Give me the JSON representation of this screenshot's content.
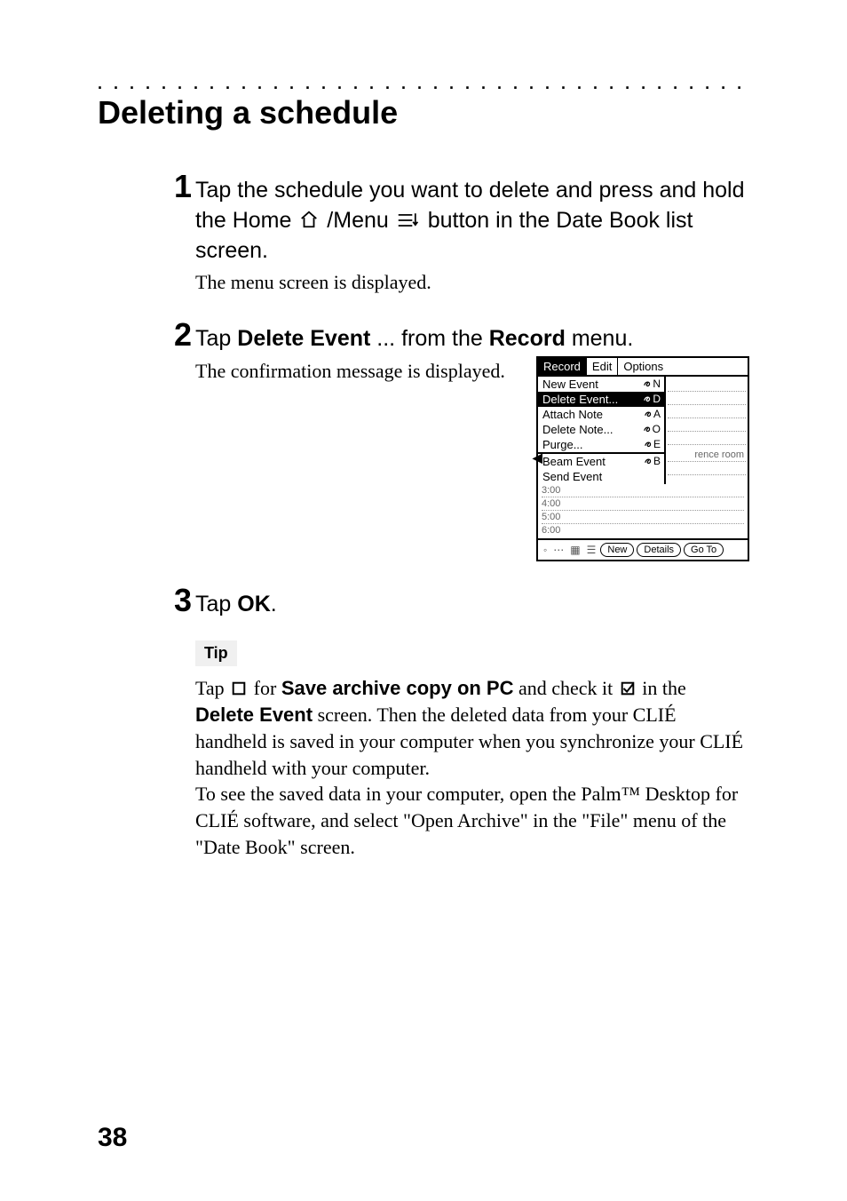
{
  "dot_row": ". . . . . . . . . . . . . . . . . . . . . . . . . . . . . . . . . . . . . . . . . . . . . . . . . . . . . . . .",
  "heading": "Deleting a schedule",
  "steps": {
    "s1": {
      "num": "1",
      "text_a": "Tap the schedule you want to delete and press and hold the Home ",
      "text_b": "/Menu ",
      "text_c": " button in the Date Book list screen.",
      "detail": "The menu screen is displayed."
    },
    "s2": {
      "num": "2",
      "text_a": "Tap ",
      "bold_a": "Delete Event",
      "text_b": "... from the ",
      "bold_b": "Record",
      "text_c": " menu.",
      "detail": "The confirmation message is displayed."
    },
    "s3": {
      "num": "3",
      "text_a": "Tap ",
      "bold_a": "OK",
      "text_b": "."
    }
  },
  "tip": {
    "label": "Tip",
    "p1_a": "Tap ",
    "p1_b": " for ",
    "p1_bold1": "Save archive copy on PC",
    "p1_c": " and check it ",
    "p1_d": " in the ",
    "p1_bold2": "Delete Event",
    "p1_e": " screen. Then the deleted data from your CLIÉ handheld is saved in your computer when you synchronize your CLIÉ handheld with your computer.",
    "p2": "To see the saved data in your computer, open the Palm™ Desktop for CLIÉ software, and select \"Open Archive\" in the \"File\" menu of the \"Date Book\" screen."
  },
  "device": {
    "menubar": {
      "record": "Record",
      "edit": "Edit",
      "options": "Options"
    },
    "menu": {
      "new_event": {
        "label": "New Event",
        "sc": "N"
      },
      "delete_event": {
        "label": "Delete Event...",
        "sc": "D"
      },
      "attach_note": {
        "label": "Attach Note",
        "sc": "A"
      },
      "delete_note": {
        "label": "Delete Note...",
        "sc": "O"
      },
      "purge": {
        "label": "Purge...",
        "sc": "E"
      },
      "beam_event": {
        "label": "Beam Event",
        "sc": "B"
      },
      "send_event": {
        "label": "Send Event",
        "sc": ""
      }
    },
    "side_label": "rence room",
    "times": {
      "t3": "3:00",
      "t4": "4:00",
      "t5": "5:00",
      "t6": "6:00"
    },
    "footer": {
      "new": "New",
      "details": "Details",
      "goto": "Go To"
    }
  },
  "page_number": "38"
}
